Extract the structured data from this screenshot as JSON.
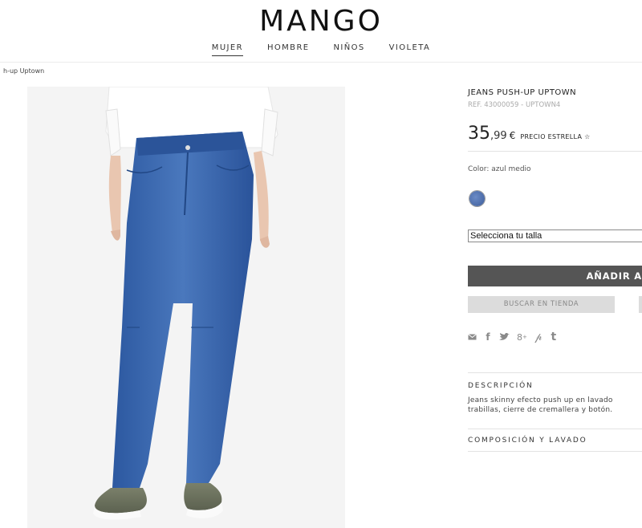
{
  "header": {
    "logo": "MANGO",
    "nav": [
      "MUJER",
      "HOMBRE",
      "NIÑOS",
      "VIOLETA"
    ]
  },
  "breadcrumb": "h-up Uptown",
  "product": {
    "name": "JEANS PUSH-UP UPTOWN",
    "ref": "REF. 43000059 - UPTOWN4",
    "price_int": "35",
    "price_dec": ",99",
    "currency": "€",
    "price_badge": "PRECIO ESTRELLA ☆",
    "color_label": "Color: azul medio",
    "size_select": "Selecciona tu talla",
    "add_button": "AÑADIR A",
    "store_button": "BUSCAR EN TIENDA"
  },
  "social_icons": [
    "email-icon",
    "facebook-icon",
    "twitter-icon",
    "google-plus-icon",
    "pinterest-icon",
    "tumblr-icon"
  ],
  "sections": {
    "description_title": "DESCRIPCIÓN",
    "description_text": "Jeans skinny efecto push up en lavado",
    "description_text2": "trabillas, cierre de cremallera y botón.",
    "composition_title": "COMPOSICIÓN Y LAVADO"
  },
  "colors": {
    "swatch": "#4e6ea8",
    "add_button_bg": "#555555",
    "store_button_bg": "#dcdcdc"
  }
}
